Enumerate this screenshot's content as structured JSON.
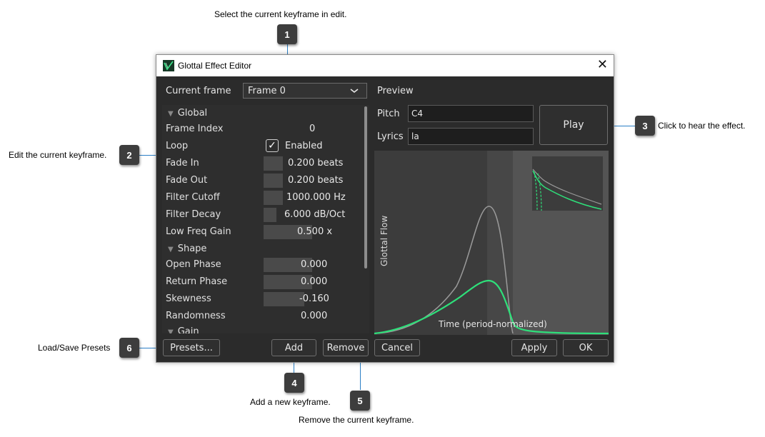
{
  "annotations": {
    "a1": {
      "num": "1",
      "text": "Select the current keyframe in edit."
    },
    "a2": {
      "num": "2",
      "text": "Edit the current keyframe."
    },
    "a3": {
      "num": "3",
      "text": "Click to hear the effect."
    },
    "a4": {
      "num": "4",
      "text": "Add a new keyframe."
    },
    "a5": {
      "num": "5",
      "text": "Remove the current keyframe."
    },
    "a6": {
      "num": "6",
      "text": "Load/Save Presets"
    }
  },
  "window": {
    "title": "Glottal Effect Editor",
    "close_glyph": "✕"
  },
  "frame_selector": {
    "label": "Current frame",
    "value": "Frame 0"
  },
  "properties": {
    "global_header": "Global",
    "frame_index": {
      "name": "Frame Index",
      "value": "0"
    },
    "loop": {
      "name": "Loop",
      "value": "Enabled",
      "checked": true
    },
    "fade_in": {
      "name": "Fade In",
      "value": "0.200 beats",
      "fill": 0.2
    },
    "fade_out": {
      "name": "Fade Out",
      "value": "0.200 beats",
      "fill": 0.2
    },
    "filter_cutoff": {
      "name": "Filter Cutoff",
      "value": "1000.000 Hz",
      "fill": 0.2
    },
    "filter_decay": {
      "name": "Filter Decay",
      "value": "6.000 dB/Oct",
      "fill": 0.13
    },
    "low_freq_gain": {
      "name": "Low Freq Gain",
      "value": "0.500 x",
      "fill": 0.5
    },
    "shape_header": "Shape",
    "open_phase": {
      "name": "Open Phase",
      "value": "0.000",
      "fill": 0.5
    },
    "return_phase": {
      "name": "Return Phase",
      "value": "0.000",
      "fill": 0.5
    },
    "skewness": {
      "name": "Skewness",
      "value": "-0.160",
      "fill": 0.42
    },
    "randomness": {
      "name": "Randomness",
      "value": "0.000",
      "fill": 0.0
    },
    "gain_header": "Gain"
  },
  "preview": {
    "label": "Preview",
    "pitch_label": "Pitch",
    "pitch_value": "C4",
    "lyrics_label": "Lyrics",
    "lyrics_value": "la",
    "play_label": "Play",
    "y_axis_label": "Glottal Flow",
    "x_axis_label": "Time (period-normalized)",
    "colors": {
      "bg": "#3c3c3c",
      "shade": "#474747",
      "green": "#2ee07a",
      "gray": "#9a9a9a"
    }
  },
  "buttons": {
    "presets": "Presets...",
    "add": "Add",
    "remove": "Remove",
    "cancel": "Cancel",
    "apply": "Apply",
    "ok": "OK"
  }
}
